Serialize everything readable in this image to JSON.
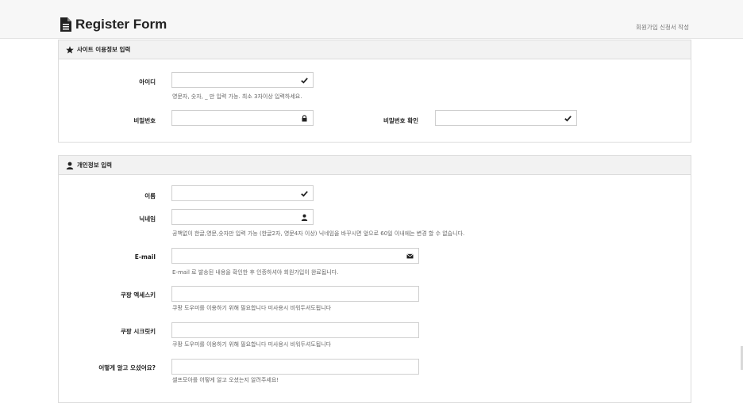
{
  "header": {
    "title": "Register Form",
    "breadcrumb": "회원가입 신청서 작성",
    "icon": "document-icon"
  },
  "site_section": {
    "title": "사이트 이용정보 입력",
    "icon": "star-icon",
    "fields": {
      "userid": {
        "label": "아이디",
        "value": "",
        "help": "영문자, 숫자, _ 만 입력 가능. 최소 3자이상 입력하세요.",
        "icon": "check-icon"
      },
      "password": {
        "label": "비밀번호",
        "value": "",
        "icon": "lock-icon"
      },
      "password_confirm": {
        "label": "비밀번호 확인",
        "value": "",
        "icon": "check-icon"
      }
    }
  },
  "personal_section": {
    "title": "개인정보 입력",
    "icon": "user-icon",
    "fields": {
      "name": {
        "label": "이름",
        "value": "",
        "icon": "check-icon"
      },
      "nickname": {
        "label": "닉네임",
        "value": "",
        "help": "공백없이 한글,영문,숫자만 입력 가능 (한글2자, 영문4자 이상) 닉네임을 바꾸시면 앞으로 60일 이내에는 변경 할 수 없습니다.",
        "icon": "user-icon"
      },
      "email": {
        "label": "E-mail",
        "value": "",
        "help": "E-mail 로 발송된 내용을 확인한 후 인증하셔야 회원가입이 완료됩니다.",
        "icon": "envelope-icon"
      },
      "coupang_access": {
        "label": "쿠팡 엑세스키",
        "value": "",
        "help": "쿠팡 도우미를 이용하기 위해 필요합니다 미사용시 비워두셔도됩니다"
      },
      "coupang_secret": {
        "label": "쿠팡 시크릿키",
        "value": "",
        "help": "쿠팡 도우미를 이용하기 위해 필요합니다 미사용시 비워두셔도됩니다"
      },
      "referral": {
        "label": "어떻게 알고 오셨어요?",
        "value": "",
        "help": "셀프모아를 어떻게 알고 오셨는지 알려주세요!"
      }
    }
  }
}
